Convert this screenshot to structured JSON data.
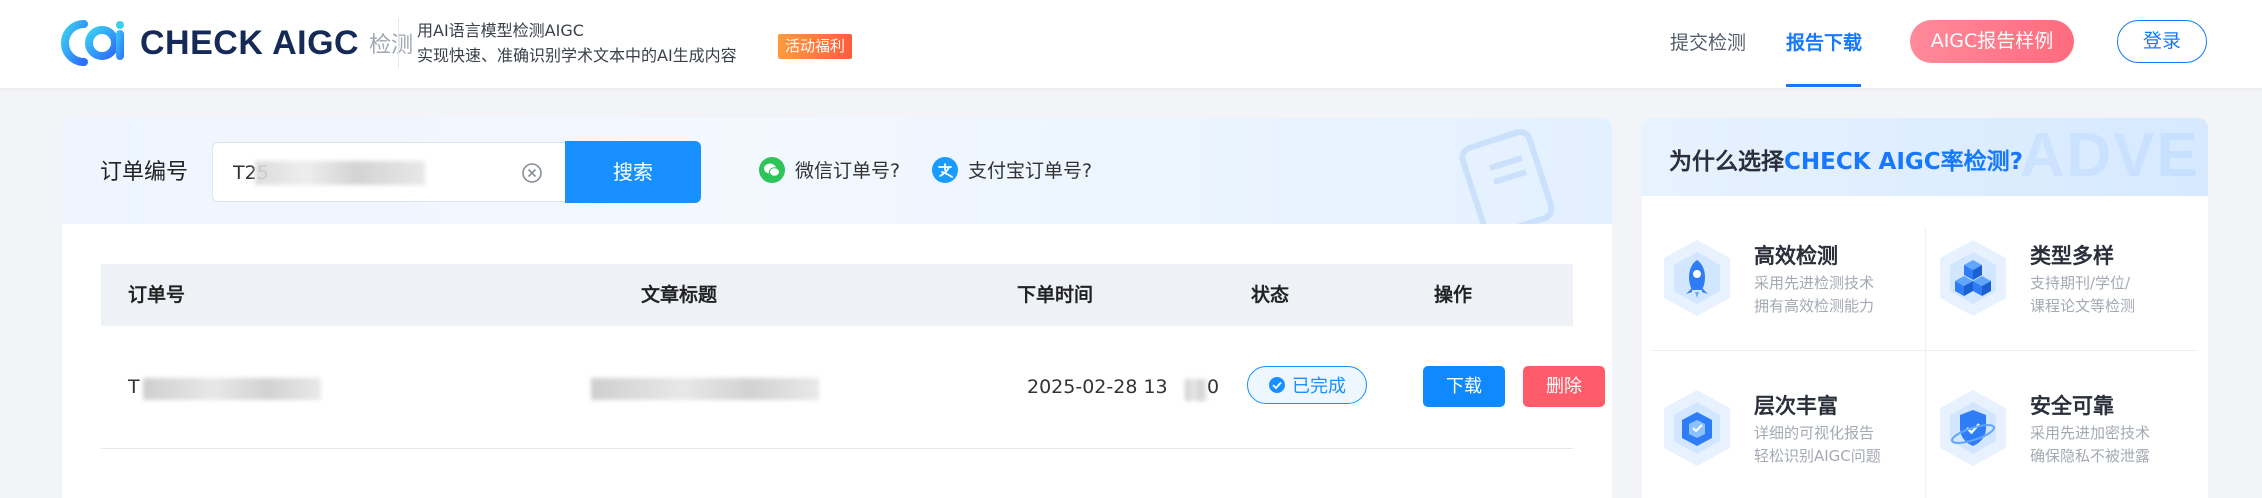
{
  "header": {
    "logo_text": "CHECK AIGC",
    "logo_sub": "检测",
    "slogan_line1": "用AI语言模型检测AIGC",
    "slogan_line2": "实现快速、准确识别学术文本中的AI生成内容",
    "promo_badge": "活动福利",
    "nav": {
      "submit": "提交检测",
      "report": "报告下载"
    },
    "sample_button": "AIGC报告样例",
    "login_button": "登录",
    "colors": {
      "accent": "#1578ff",
      "sample": "#ff7586",
      "promo": "#ff7a3d"
    }
  },
  "search": {
    "label": "订单编号",
    "input_value": "T25",
    "button": "搜索",
    "wechat_help": "微信订单号?",
    "alipay_help": "支付宝订单号?"
  },
  "table": {
    "headers": {
      "order_no": "订单号",
      "title": "文章标题",
      "time": "下单时间",
      "status": "状态",
      "action": "操作"
    },
    "rows": [
      {
        "order_no": "T",
        "title": "",
        "time": "2025-02-28 13",
        "time_tail": "0",
        "status": "已完成",
        "download": "下载",
        "delete": "删除"
      }
    ]
  },
  "side": {
    "title_prefix": "为什么选择",
    "title_highlight": "CHECK AIGC率检测?",
    "features": [
      {
        "icon": "rocket-icon",
        "title": "高效检测",
        "desc1": "采用先进检测技术",
        "desc2": "拥有高效检测能力"
      },
      {
        "icon": "cubes-icon",
        "title": "类型多样",
        "desc1": "支持期刊/学位/",
        "desc2": "课程论文等检测"
      },
      {
        "icon": "layers-icon",
        "title": "层次丰富",
        "desc1": "详细的可视化报告",
        "desc2": "轻松识别AIGC问题"
      },
      {
        "icon": "shield-icon",
        "title": "安全可靠",
        "desc1": "采用先进加密技术",
        "desc2": "确保隐私不被泄露"
      }
    ]
  }
}
